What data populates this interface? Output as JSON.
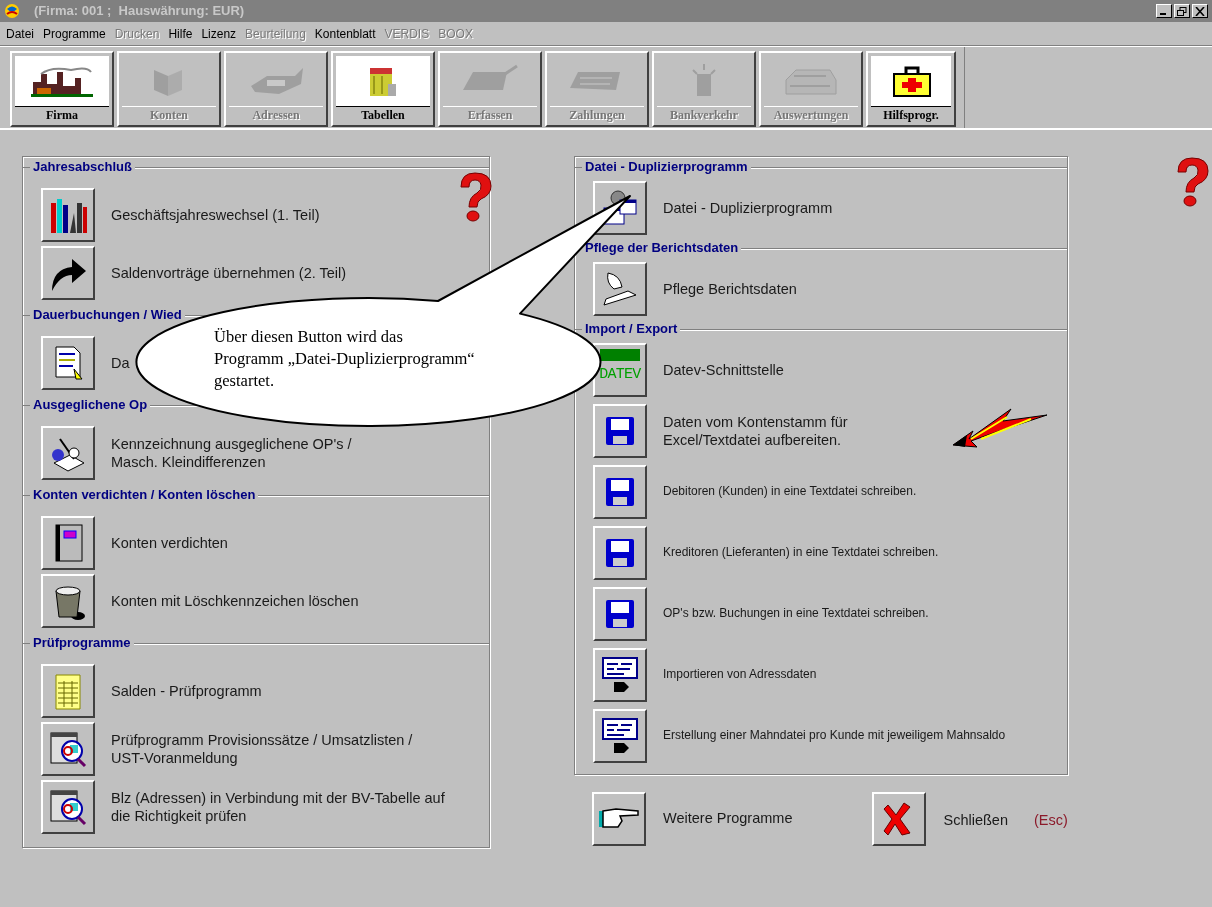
{
  "window": {
    "title": "(Firma: 001 ;  Hauswährung: EUR)"
  },
  "menu": [
    {
      "label": "Datei",
      "disabled": false
    },
    {
      "label": "Programme",
      "disabled": false
    },
    {
      "label": "Drucken",
      "disabled": true
    },
    {
      "label": "Hilfe",
      "disabled": false
    },
    {
      "label": "Lizenz",
      "disabled": false
    },
    {
      "label": "Beurteilung",
      "disabled": true
    },
    {
      "label": "Kontenblatt",
      "disabled": false
    },
    {
      "label": "VERDIS",
      "disabled": true
    },
    {
      "label": "BOOX",
      "disabled": true
    }
  ],
  "toolbar": [
    {
      "label": "Firma",
      "disabled": false
    },
    {
      "label": "Konten",
      "disabled": true
    },
    {
      "label": "Adressen",
      "disabled": true
    },
    {
      "label": "Tabellen",
      "disabled": false
    },
    {
      "label": "Erfassen",
      "disabled": true
    },
    {
      "label": "Zahlungen",
      "disabled": true
    },
    {
      "label": "Bankverkehr",
      "disabled": true
    },
    {
      "label": "Auswertungen",
      "disabled": true
    },
    {
      "label": "Hilfsprogr.",
      "disabled": false
    }
  ],
  "left_panel": [
    {
      "title": "Jahresabschluß",
      "items": [
        {
          "label": "Geschäftsjahreswechsel (1. Teil)",
          "small": false
        },
        {
          "label": "Saldenvorträge übernehmen (2. Teil)",
          "small": false
        }
      ]
    },
    {
      "title": "Dauerbuchungen / Wied",
      "items": [
        {
          "label": "Da",
          "small": false
        }
      ]
    },
    {
      "title": "Ausgeglichene Op",
      "items": [
        {
          "label": "Kennzeichnung ausgeglichene OP's /\nMasch. Kleindifferenzen",
          "small": false
        }
      ]
    },
    {
      "title": "Konten verdichten / Konten löschen",
      "items": [
        {
          "label": "Konten verdichten",
          "small": false
        },
        {
          "label": "Konten mit Löschkennzeichen löschen",
          "small": false
        }
      ]
    },
    {
      "title": "Prüfprogramme",
      "items": [
        {
          "label": "Salden - Prüfprogramm",
          "small": false
        },
        {
          "label": "Prüfprogramm Provisionssätze / Umsatzlisten /\nUST-Voranmeldung",
          "small": false
        },
        {
          "label": "Blz (Adressen) in Verbindung mit der BV-Tabelle auf\ndie Richtigkeit prüfen",
          "small": false
        }
      ]
    }
  ],
  "right_panel": [
    {
      "title": "Datei - Duplizierprogramm",
      "items": [
        {
          "label": "Datei - Duplizierprogramm",
          "small": false
        }
      ]
    },
    {
      "title": "Pflege der Berichtsdaten",
      "items": [
        {
          "label": "Pflege Berichtsdaten",
          "small": false
        }
      ]
    },
    {
      "title": "Import / Export",
      "items": [
        {
          "label": "Datev-Schnittstelle",
          "small": false
        },
        {
          "label": "Daten vom Kontenstamm für\nExcel/Textdatei aufbereiten.",
          "small": false
        },
        {
          "label": "Debitoren (Kunden) in eine Textdatei schreiben.",
          "small": true
        },
        {
          "label": "Kreditoren (Lieferanten) in eine Textdatei schreiben.",
          "small": true
        },
        {
          "label": "OP's bzw. Buchungen in eine Textdatei schreiben.",
          "small": true
        },
        {
          "label": "Importieren von Adressdaten",
          "small": true
        },
        {
          "label": "Erstellung einer Mahndatei pro Kunde mit jeweiligem Mahnsaldo",
          "small": true
        }
      ]
    }
  ],
  "datev_icon_text": "DATEV",
  "more_button": {
    "label": "Weitere Programme"
  },
  "close_button": {
    "label": "Schließen",
    "shortcut": "(Esc)"
  },
  "callout": {
    "text": "Über diesen Button wird das Programm „Datei-Duplizierprogramm“ gestartet."
  }
}
